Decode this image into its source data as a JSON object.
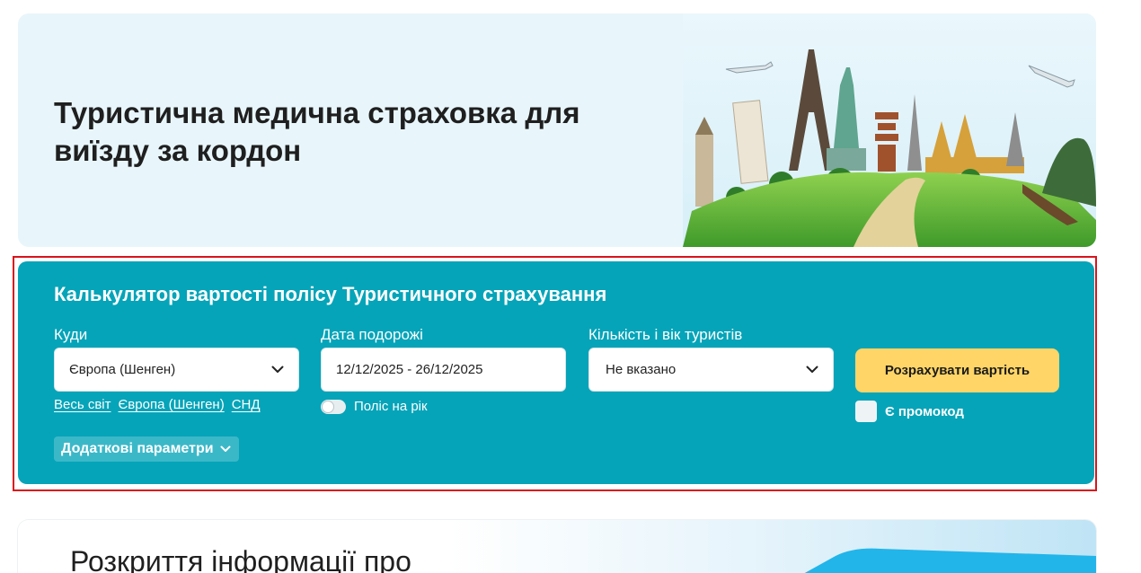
{
  "hero": {
    "title": "Туристична медична страховка для виїзду за кордон"
  },
  "calculator": {
    "title": "Калькулятор вартості полісу Туристичного страхування",
    "destination": {
      "label": "Куди",
      "value": "Європа (Шенген)",
      "quick_links": [
        "Весь світ",
        "Європа (Шенген)",
        "СНД"
      ]
    },
    "dates": {
      "label": "Дата подорожі",
      "value": "12/12/2025 - 26/12/2025",
      "annual_toggle_label": "Поліс на рік"
    },
    "tourists": {
      "label": "Кількість і вік туристів",
      "value": "Не вказано"
    },
    "submit_label": "Розрахувати вартість",
    "promo_label": "Є промокод",
    "extra_params_label": "Додаткові параметри"
  },
  "info": {
    "title": "Розкриття інформації про"
  },
  "colors": {
    "calculator_bg": "#05a4b9",
    "hero_bg": "#e8f6fb",
    "button_bg": "#ffd567",
    "highlight_border": "#d9141c"
  },
  "icons": {
    "dropdown": "chevron-down-icon",
    "hero_art": "travel-landmarks-illustration"
  }
}
